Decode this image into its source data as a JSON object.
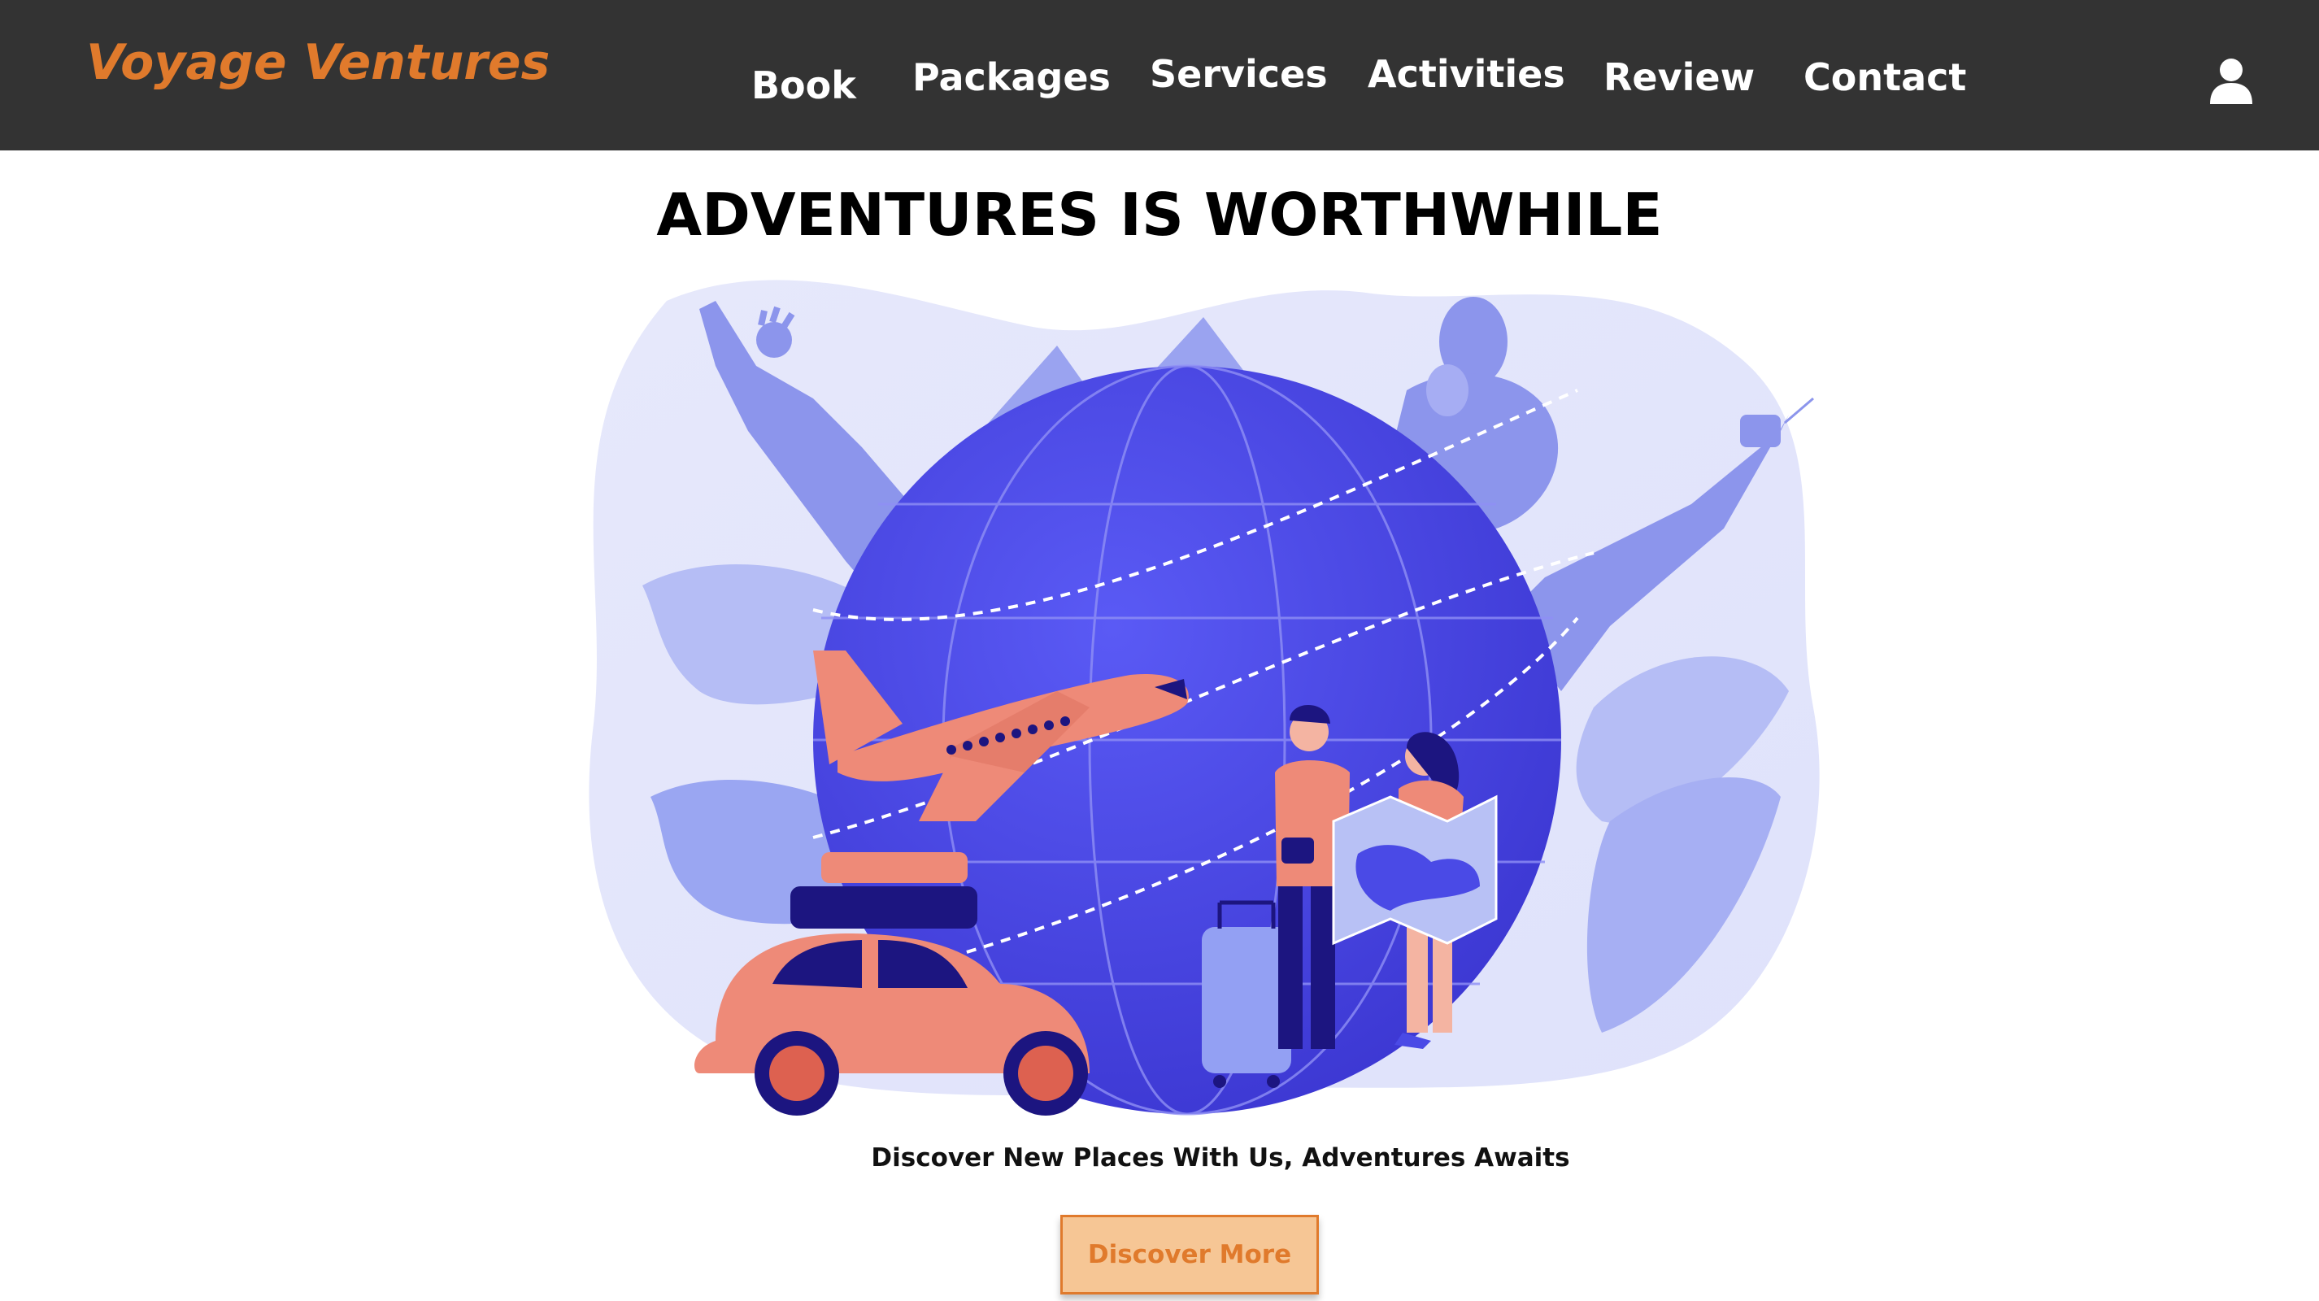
{
  "header": {
    "brand": "Voyage Ventures",
    "nav": [
      {
        "label": "Book"
      },
      {
        "label": "Packages"
      },
      {
        "label": "Services"
      },
      {
        "label": "Activities"
      },
      {
        "label": "Review"
      },
      {
        "label": "Contact"
      }
    ],
    "user_icon": "user-icon"
  },
  "hero": {
    "title": "ADVENTURES IS WORTHWHILE",
    "illustration": "travel-illustration",
    "tagline": "Discover New Places With Us, Adventures Awaits",
    "cta_label": "Discover More"
  },
  "colors": {
    "navbar_bg": "#333333",
    "brand": "#e07a2c",
    "cta_bg": "#f6c695",
    "globe": "#4a4ae6",
    "coral": "#ee8a78",
    "navy": "#1c1580"
  }
}
